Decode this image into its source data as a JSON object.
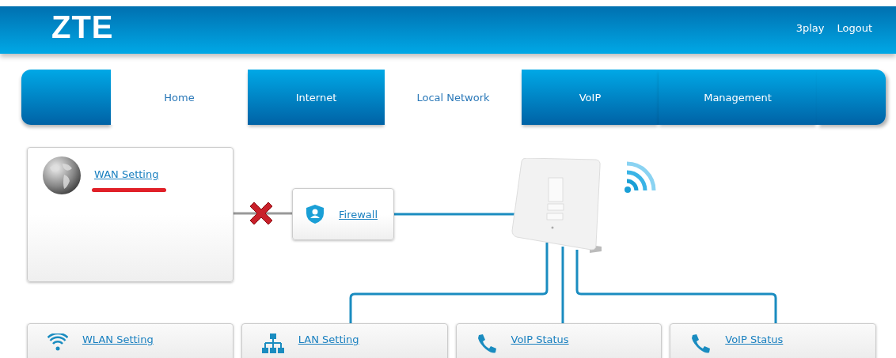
{
  "header": {
    "logo": "ZTE",
    "links": [
      "3play",
      "Logout"
    ]
  },
  "tabs": [
    {
      "label": "Home",
      "selected": true
    },
    {
      "label": "Internet",
      "selected": false
    },
    {
      "label": "Local Network",
      "selected": true
    },
    {
      "label": "VoIP",
      "selected": false
    },
    {
      "label": "Management",
      "selected": false
    }
  ],
  "wan": {
    "link": "WAN Setting",
    "connected": false
  },
  "firewall": {
    "link": "Firewall"
  },
  "devices": [
    {
      "kind": "wifi",
      "link": "WLAN Setting"
    },
    {
      "kind": "lan",
      "link": "LAN Setting"
    },
    {
      "kind": "phone",
      "link": "VoIP Status"
    },
    {
      "kind": "phone",
      "link": "VoIP Status"
    }
  ]
}
